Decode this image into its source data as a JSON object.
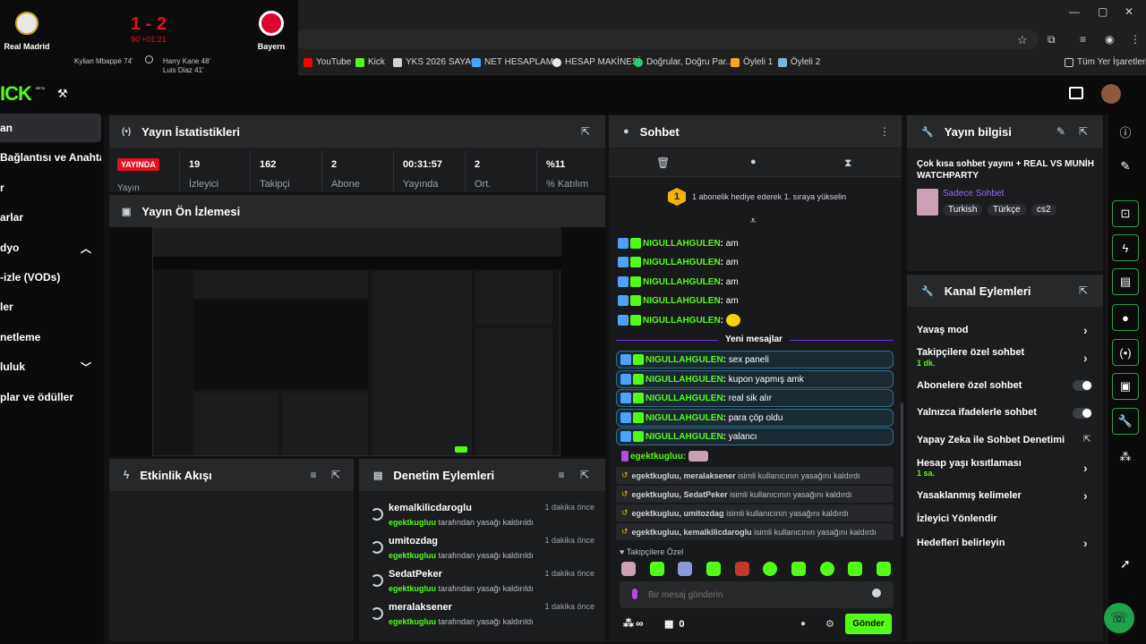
{
  "scoreboard": {
    "home": "Real Madrid",
    "away": "Bayern",
    "score": "1 - 2",
    "time": "90'+01:21",
    "home_scorers": "Kylian Mbappé 74'",
    "away_scorers_1": "Harry Kane 48'",
    "away_scorers_2": "Luis Diaz 41'"
  },
  "bookmarks": [
    "YouTube",
    "Kick",
    "YKS 2026 SAYAÇ",
    "NET HESAPLAMA",
    "HESAP MAKİNESİ",
    "Doğrular, Doğru Par...",
    "Öyleli 1",
    "Öyleli 2",
    "Tüm Yer İşaretleri"
  ],
  "brand": {
    "logo": "ICK",
    "beta": "BETA"
  },
  "sidebar": [
    "an",
    "Bağlantısı ve Anahtarı",
    "r",
    "arlar",
    "dyo",
    "-izle (VODs)",
    "ler",
    "netleme",
    "luluk",
    "plar ve ödüller"
  ],
  "stats_panel": {
    "title": "Yayın İstatistikleri",
    "live_badge": "YAYINDA",
    "live_label": "Yayın",
    "items": [
      {
        "value": "19",
        "label": "İzleyici"
      },
      {
        "value": "162",
        "label": "Takipçi"
      },
      {
        "value": "2",
        "label": "Abone"
      },
      {
        "value": "00:31:57",
        "label": "Yayında"
      },
      {
        "value": "2",
        "label": "Ort."
      },
      {
        "value": "%11",
        "label": "% Katılım"
      }
    ]
  },
  "preview_panel": {
    "title": "Yayın Ön İzlemesi"
  },
  "activity_panel": {
    "title": "Etkinlik Akışı"
  },
  "moderation_panel": {
    "title": "Denetim Eylemleri",
    "items": [
      {
        "user": "kemalkilicdaroglu",
        "by": "egektkugluu",
        "action": "tarafından yasağı kaldırıldı",
        "time": "1 dakika önce"
      },
      {
        "user": "umitozdag",
        "by": "egektkugluu",
        "action": "tarafından yasağı kaldırıldı",
        "time": "1 dakika önce"
      },
      {
        "user": "SedatPeker",
        "by": "egektkugluu",
        "action": "tarafından yasağı kaldırıldı",
        "time": "1 dakika önce"
      },
      {
        "user": "meralaksener",
        "by": "egektkugluu",
        "action": "tarafından yasağı kaldırıldı",
        "time": "1 dakika önce"
      }
    ]
  },
  "chat": {
    "title": "Sohbet",
    "gift_banner": "1 abonelik hediye ederek 1. sıraya yükselin",
    "gift_rank": "1",
    "new_messages": "Yeni mesajlar",
    "messages": [
      {
        "user": "NIGULLAHGULEN",
        "text": "am"
      },
      {
        "user": "NIGULLAHGULEN",
        "text": "am"
      },
      {
        "user": "NIGULLAHGULEN",
        "text": "am"
      },
      {
        "user": "NIGULLAHGULEN",
        "text": "am"
      },
      {
        "user": "NIGULLAHGULEN",
        "text": ""
      }
    ],
    "new": [
      {
        "user": "NIGULLAHGULEN",
        "text": "sex paneli"
      },
      {
        "user": "NIGULLAHGULEN",
        "text": "kupon yapmış amk"
      },
      {
        "user": "NIGULLAHGULEN",
        "text": "real sik alır"
      },
      {
        "user": "NIGULLAHGULEN",
        "text": "para çöp oldu"
      },
      {
        "user": "NIGULLAHGULEN",
        "text": "yalancı"
      }
    ],
    "self_user": "egektkugluu:",
    "mod_lines": [
      {
        "users": "egektkugluu, meralaksener",
        "text": "isimli kullanıcının yasağını kaldırdı"
      },
      {
        "users": "egektkugluu, SedatPeker",
        "text": "isimli kullanıcının yasağını kaldırdı"
      },
      {
        "users": "egektkugluu, umitozdag",
        "text": "isimli kullanıcının yasağını kaldırdı"
      },
      {
        "users": "egektkugluu, kemalkilicdaroglu",
        "text": "isimli kullanıcının yasağını kaldırdı"
      }
    ],
    "followers_only": "Takipçilere Özel",
    "input_placeholder": "Bir mesaj gönderin",
    "infinity": "∞",
    "count": "0",
    "send": "Gönder"
  },
  "info_panel": {
    "title": "Yayın bilgisi",
    "stream_title": "Çok kısa sohbet yayını + REAL VS MUNİH WATCHPARTY",
    "category": "Sadece Sohbet",
    "tags": [
      "Turkish",
      "Türkçe",
      "cs2"
    ]
  },
  "channel_actions": {
    "title": "Kanal Eylemleri",
    "items": [
      {
        "label": "Yavaş mod",
        "sub": "",
        "control": "chevron"
      },
      {
        "label": "Takipçilere özel sohbet",
        "sub": "1 dk.",
        "control": "chevron"
      },
      {
        "label": "Abonelere özel sohbet",
        "sub": "",
        "control": "toggle"
      },
      {
        "label": "Yalnızca ifadelerle sohbet",
        "sub": "",
        "control": "toggle"
      },
      {
        "label": "Yapay Zeka ile Sohbet Denetimi",
        "sub": "",
        "control": "external"
      },
      {
        "label": "Hesap yaşı kısıtlaması",
        "sub": "1 sa.",
        "control": "chevron"
      },
      {
        "label": "Yasaklanmış kelimeler",
        "sub": "",
        "control": "chevron"
      },
      {
        "label": "İzleyici Yönlendir",
        "sub": "",
        "control": "none"
      },
      {
        "label": "Hedefleri belirleyin",
        "sub": "",
        "control": "chevron"
      }
    ]
  },
  "colors": {
    "accent": "#53fc18",
    "live": "#e5101e",
    "panel": "#1b1c1e",
    "header": "#26282a"
  }
}
